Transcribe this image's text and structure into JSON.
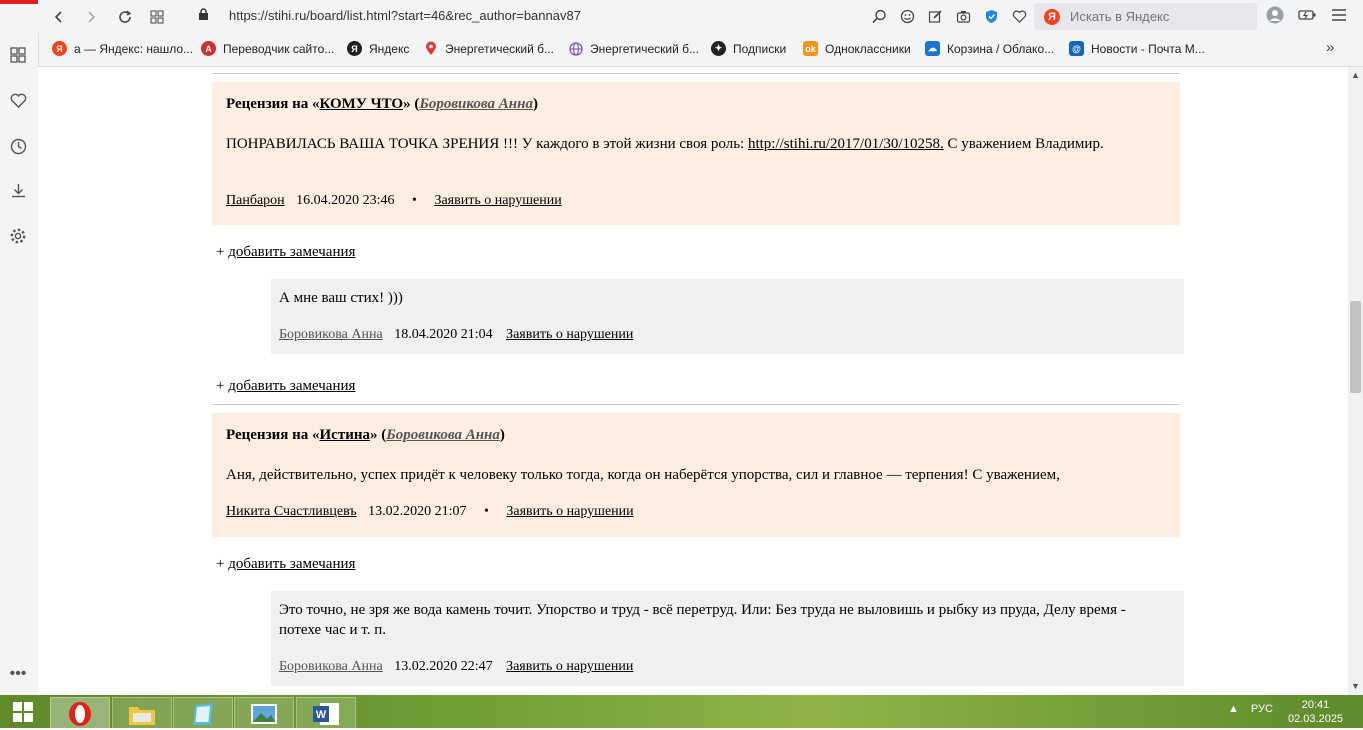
{
  "browser": {
    "url": "https://stihi.ru/board/list.html?start=46&rec_author=bannav87",
    "search_placeholder": "Искать в Яндекс",
    "bookmarks": [
      {
        "label": "а — Яндекс: нашло...",
        "icon": "yandex-icon",
        "color": "#fc3f1d"
      },
      {
        "label": "Переводчик сайто...",
        "icon": "translator-icon",
        "color": "#d32f2f"
      },
      {
        "label": "Яндекс",
        "icon": "yandex-icon",
        "color": "#222222"
      },
      {
        "label": "Энергетический б...",
        "icon": "location-pin-icon",
        "color": "#e53935"
      },
      {
        "label": "Энергетический б...",
        "icon": "globe-icon",
        "color": "#7e57c2"
      },
      {
        "label": "Подписки",
        "icon": "plus-icon",
        "color": "#222222"
      },
      {
        "label": "Одноклассники",
        "icon": "odnoklassniki-icon",
        "color": "#f7931e"
      },
      {
        "label": "Корзина / Облако...",
        "icon": "cloud-icon",
        "color": "#1976d2"
      },
      {
        "label": "Новости - Почта М...",
        "icon": "mail-icon",
        "color": "#1565c0"
      }
    ]
  },
  "reviews": [
    {
      "prefix": "Рецензия на «",
      "work": "КОМУ ЧТО",
      "mid": "» (",
      "author": "Боровикова Анна",
      "suffix": ")",
      "text_before": "ПОНРАВИЛАСЬ ВАША ТОЧКА ЗРЕНИЯ !!! У каждого в этой жизни своя роль: ",
      "link": "http://stihi.ru/2017/01/30/10258.",
      "text_after": " С уважением Владимир.",
      "reviewer": "Панбарон",
      "date": "16.04.2020 23:46",
      "report": "Заявить о нарушении",
      "reply": {
        "text": "А мне ваш стих! )))",
        "author": "Боровикова Анна",
        "date": "18.04.2020 21:04",
        "report": "Заявить о нарушении"
      }
    },
    {
      "prefix": "Рецензия на «",
      "work": "Истина",
      "mid": "» (",
      "author": "Боровикова Анна",
      "suffix": ")",
      "text": "Аня, действительно, успех придёт к человеку только тогда, когда он наберётся упорства, сил и главное — терпения! С уважением,",
      "reviewer": "Никита Счастливцевъ",
      "date": "13.02.2020 21:07",
      "report": "Заявить о нарушении",
      "reply": {
        "text": "Это точно, не зря же вода камень точит. Упорство и труд - всё перетруд. Или: Без труда не выловишь и рыбку из пруда, Делу время - потехе час и т. п.",
        "author": "Боровикова Анна",
        "date": "13.02.2020 22:47",
        "report": "Заявить о нарушении"
      }
    }
  ],
  "add_note": {
    "plus": "+ ",
    "label": "добавить замечания"
  },
  "taskbar": {
    "lang": "РУС",
    "time": "20:41",
    "date": "02.03.2025"
  }
}
